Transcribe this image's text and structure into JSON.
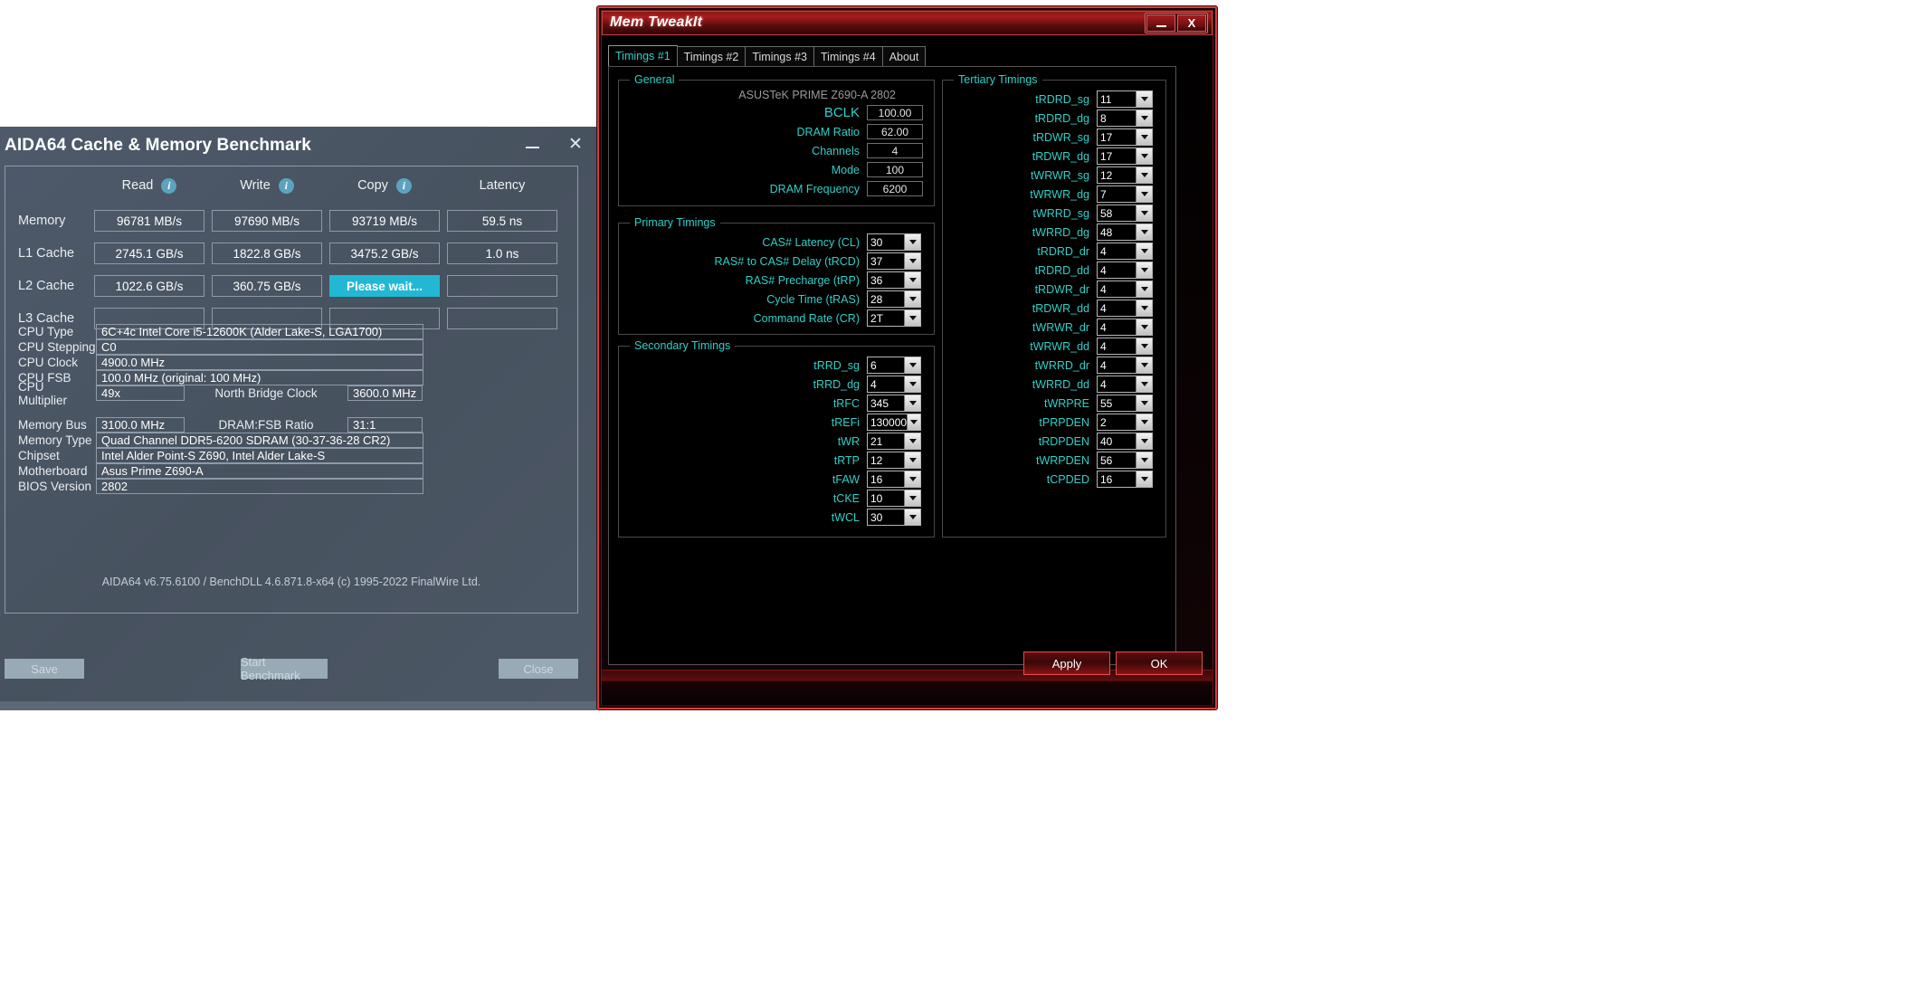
{
  "aida": {
    "title": "AIDA64 Cache & Memory Benchmark",
    "window_buttons": {
      "minimize": "minimize-icon",
      "close": "✕"
    },
    "benchmark": {
      "columns": [
        "Read",
        "Write",
        "Copy",
        "Latency"
      ],
      "rows": [
        {
          "label": "Memory",
          "read": "96781 MB/s",
          "write": "97690 MB/s",
          "copy": "93719 MB/s",
          "latency": "59.5 ns"
        },
        {
          "label": "L1 Cache",
          "read": "2745.1 GB/s",
          "write": "1822.8 GB/s",
          "copy": "3475.2 GB/s",
          "latency": "1.0 ns"
        },
        {
          "label": "L2 Cache",
          "read": "1022.6 GB/s",
          "write": "360.75 GB/s",
          "copy": "Please wait...",
          "latency": ""
        },
        {
          "label": "L3 Cache",
          "read": "",
          "write": "",
          "copy": "",
          "latency": ""
        }
      ],
      "busy_cell_text": "Please wait...",
      "busy_color": "#22b8d4"
    },
    "info": {
      "cpu_type_label": "CPU Type",
      "cpu_type_value": "6C+4c Intel Core i5-12600K  (Alder Lake-S, LGA1700)",
      "cpu_stepping_label": "CPU Stepping",
      "cpu_stepping_value": "C0",
      "cpu_clock_label": "CPU Clock",
      "cpu_clock_value": "4900.0 MHz",
      "cpu_fsb_label": "CPU FSB",
      "cpu_fsb_value": "100.0 MHz  (original: 100 MHz)",
      "cpu_multiplier_label": "CPU Multiplier",
      "cpu_multiplier_value": "49x",
      "north_bridge_label": "North Bridge Clock",
      "north_bridge_value": "3600.0 MHz",
      "memory_bus_label": "Memory Bus",
      "memory_bus_value": "3100.0 MHz",
      "dram_fsb_label": "DRAM:FSB Ratio",
      "dram_fsb_value": "31:1",
      "memory_type_label": "Memory Type",
      "memory_type_value": "Quad Channel DDR5-6200 SDRAM  (30-37-36-28 CR2)",
      "chipset_label": "Chipset",
      "chipset_value": "Intel Alder Point-S Z690, Intel Alder Lake-S",
      "motherboard_label": "Motherboard",
      "motherboard_value": "Asus Prime Z690-A",
      "bios_label": "BIOS Version",
      "bios_value": "2802"
    },
    "footer": "AIDA64 v6.75.6100 / BenchDLL 4.6.871.8-x64  (c) 1995-2022 FinalWire Ltd.",
    "buttons": {
      "save": "Save",
      "start": "Start Benchmark",
      "close": "Close"
    }
  },
  "memtweakit": {
    "title": "Mem TweakIt",
    "window_buttons": {
      "minimize": "minimize-icon",
      "close": "X"
    },
    "tabs": [
      {
        "label": "Timings #1",
        "active": true
      },
      {
        "label": "Timings #2",
        "active": false
      },
      {
        "label": "Timings #3",
        "active": false
      },
      {
        "label": "Timings #4",
        "active": false
      },
      {
        "label": "About",
        "active": false
      }
    ],
    "general": {
      "legend": "General",
      "board_name": "ASUSTeK PRIME Z690-A 2802",
      "fields": [
        {
          "label": "BCLK",
          "value": "100.00"
        },
        {
          "label": "DRAM Ratio",
          "value": "62.00"
        },
        {
          "label": "Channels",
          "value": "4"
        },
        {
          "label": "Mode",
          "value": "100"
        },
        {
          "label": "DRAM Frequency",
          "value": "6200"
        }
      ]
    },
    "primary": {
      "legend": "Primary Timings",
      "fields": [
        {
          "label": "CAS# Latency (CL)",
          "value": "30"
        },
        {
          "label": "RAS# to CAS# Delay (tRCD)",
          "value": "37"
        },
        {
          "label": "RAS# Precharge (tRP)",
          "value": "36"
        },
        {
          "label": "Cycle Time (tRAS)",
          "value": "28"
        },
        {
          "label": "Command Rate (CR)",
          "value": "2T"
        }
      ]
    },
    "secondary": {
      "legend": "Secondary Timings",
      "fields": [
        {
          "label": "tRRD_sg",
          "value": "6"
        },
        {
          "label": "tRRD_dg",
          "value": "4"
        },
        {
          "label": "tRFC",
          "value": "345"
        },
        {
          "label": "tREFi",
          "value": "130000"
        },
        {
          "label": "tWR",
          "value": "21"
        },
        {
          "label": "tRTP",
          "value": "12"
        },
        {
          "label": "tFAW",
          "value": "16"
        },
        {
          "label": "tCKE",
          "value": "10"
        },
        {
          "label": "tWCL",
          "value": "30"
        }
      ]
    },
    "tertiary": {
      "legend": "Tertiary Timings",
      "fields": [
        {
          "label": "tRDRD_sg",
          "value": "11"
        },
        {
          "label": "tRDRD_dg",
          "value": "8"
        },
        {
          "label": "tRDWR_sg",
          "value": "17"
        },
        {
          "label": "tRDWR_dg",
          "value": "17"
        },
        {
          "label": "tWRWR_sg",
          "value": "12"
        },
        {
          "label": "tWRWR_dg",
          "value": "7"
        },
        {
          "label": "tWRRD_sg",
          "value": "58"
        },
        {
          "label": "tWRRD_dg",
          "value": "48"
        },
        {
          "label": "tRDRD_dr",
          "value": "4"
        },
        {
          "label": "tRDRD_dd",
          "value": "4"
        },
        {
          "label": "tRDWR_dr",
          "value": "4"
        },
        {
          "label": "tRDWR_dd",
          "value": "4"
        },
        {
          "label": "tWRWR_dr",
          "value": "4"
        },
        {
          "label": "tWRWR_dd",
          "value": "4"
        },
        {
          "label": "tWRRD_dr",
          "value": "4"
        },
        {
          "label": "tWRRD_dd",
          "value": "4"
        },
        {
          "label": "tWRPRE",
          "value": "55"
        },
        {
          "label": "tPRPDEN",
          "value": "2"
        },
        {
          "label": "tRDPDEN",
          "value": "40"
        },
        {
          "label": "tWRPDEN",
          "value": "56"
        },
        {
          "label": "tCPDED",
          "value": "16"
        }
      ]
    },
    "actions": {
      "apply": "Apply",
      "ok": "OK"
    }
  }
}
